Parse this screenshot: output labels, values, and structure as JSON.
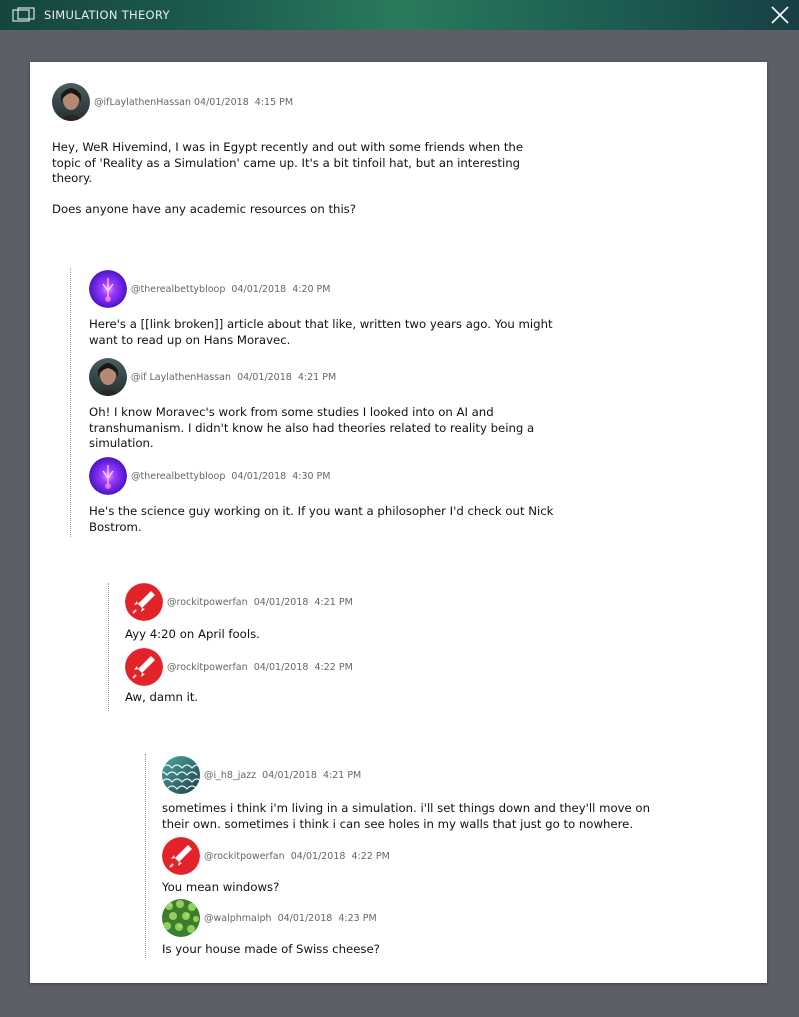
{
  "window": {
    "title": "SIMULATION THEORY"
  },
  "main_post": {
    "handle": "@ifLaylathenHassan",
    "date": "04/01/2018",
    "time": "4:15 PM",
    "body": "Hey, WeR Hivemind, I was in Egypt recently and out with some friends when the\ntopic of 'Reality as a Simulation' came up. It's a bit tinfoil hat, but an interesting\ntheory.\n\nDoes anyone have any academic resources on this?"
  },
  "thread1": [
    {
      "handle": "@therealbettybloop",
      "date": "04/01/2018",
      "time": "4:20 PM",
      "avatar": "purple-orb",
      "body": "Here's a [[link broken]] article about that like, written two years ago. You might\nwant to read up on Hans Moravec."
    },
    {
      "handle": "@if LaylathenHassan",
      "date": "04/01/2018",
      "time": "4:21 PM",
      "avatar": "portrait",
      "body": "Oh! I know Moravec's work from some studies I looked into on AI and\ntranshumanism. I didn't know he also had theories related to reality being a\nsimulation."
    },
    {
      "handle": "@therealbettybloop",
      "date": "04/01/2018",
      "time": "4:30 PM",
      "avatar": "purple-orb",
      "body": "He's the science guy working on it. If you want a philosopher I'd check out Nick\nBostrom."
    }
  ],
  "thread2": [
    {
      "handle": "@rockitpowerfan",
      "date": "04/01/2018",
      "time": "4:21 PM",
      "avatar": "rocket",
      "body": "Ayy 4:20 on April fools."
    },
    {
      "handle": "@rockitpowerfan",
      "date": "04/01/2018",
      "time": "4:22 PM",
      "avatar": "rocket",
      "body": "Aw, damn it."
    }
  ],
  "thread3": [
    {
      "handle": "@i_h8_jazz",
      "date": "04/01/2018",
      "time": "4:21 PM",
      "avatar": "scales",
      "body": "sometimes i think i'm living in a simulation. i'll set things down and they'll move on\ntheir own. sometimes i think i can see holes in my walls that just go to nowhere."
    },
    {
      "handle": "@rockitpowerfan",
      "date": "04/01/2018",
      "time": "4:22 PM",
      "avatar": "rocket",
      "body": "You mean windows?"
    },
    {
      "handle": "@walphmalph",
      "date": "04/01/2018",
      "time": "4:23 PM",
      "avatar": "leaves",
      "body": "Is your house made of Swiss cheese?"
    }
  ],
  "colors": {
    "accent_teal": "#1c5a4f",
    "rocket_red": "#e3232a",
    "orb_purple": "#7a2ff0"
  }
}
